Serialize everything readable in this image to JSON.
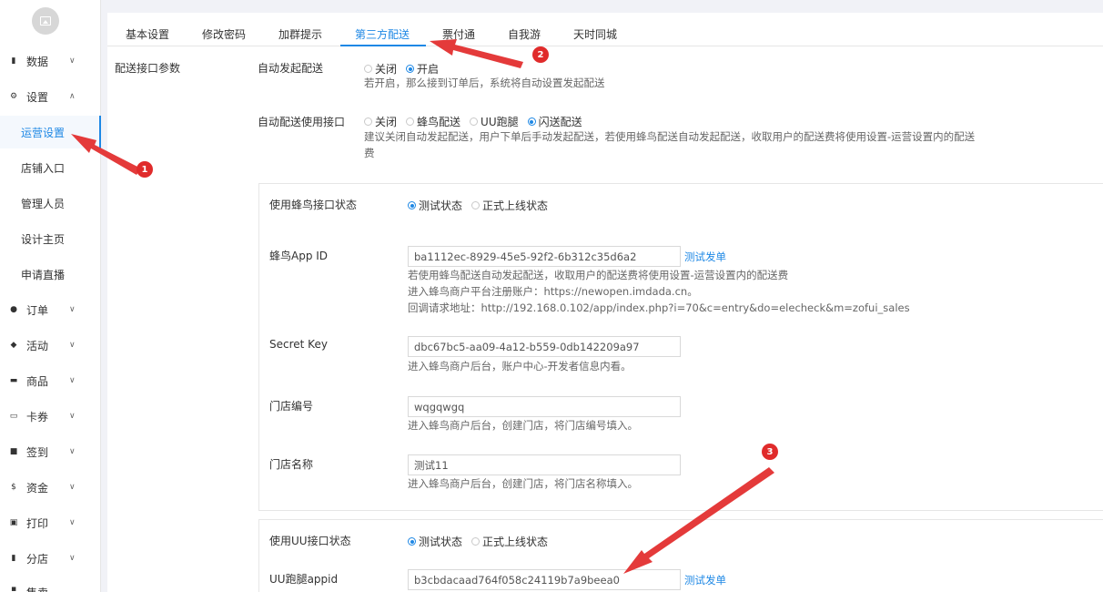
{
  "sidebar": {
    "items": [
      {
        "label": "数据",
        "icon": "bar-chart-icon"
      },
      {
        "label": "设置",
        "icon": "gear-icon"
      },
      {
        "label": "订单",
        "icon": "info-icon"
      },
      {
        "label": "活动",
        "icon": "tag-icon"
      },
      {
        "label": "商品",
        "icon": "basket-icon"
      },
      {
        "label": "卡券",
        "icon": "card-icon"
      },
      {
        "label": "签到",
        "icon": "cube-icon"
      },
      {
        "label": "资金",
        "icon": "dollar-icon"
      },
      {
        "label": "打印",
        "icon": "printer-icon"
      },
      {
        "label": "分店",
        "icon": "bar-chart-icon"
      },
      {
        "label": "售卖"
      }
    ],
    "sub_items": [
      "运营设置",
      "店铺入口",
      "管理人员",
      "设计主页",
      "申请直播"
    ]
  },
  "tabs": [
    "基本设置",
    "修改密码",
    "加群提示",
    "第三方配送",
    "票付通",
    "自我游",
    "天时同城"
  ],
  "section_label": "配送接口参数",
  "auto_dispatch": {
    "label": "自动发起配送",
    "options": [
      "关闭",
      "开启"
    ],
    "help": "若开启，那么接到订单后，系统将自动设置发起配送"
  },
  "auto_interface": {
    "label": "自动配送使用接口",
    "options": [
      "关闭",
      "蜂鸟配送",
      "UU跑腿",
      "闪送配送"
    ],
    "help_line1": "建议关闭自动发起配送，用户下单后手动发起配送，若使用蜂鸟配送自动发起配送，收取用户的配送费将使用设置-运营设置内的配送",
    "help_line2": "费"
  },
  "fengniao": {
    "status_label": "使用蜂鸟接口状态",
    "status_options": [
      "测试状态",
      "正式上线状态"
    ],
    "appid_label": "蜂鸟App ID",
    "appid_value": "ba1112ec-8929-45e5-92f2-6b312c35d6a2",
    "test_link": "测试发单",
    "appid_help1": "若使用蜂鸟配送自动发起配送，收取用户的配送费将使用设置-运营设置内的配送费",
    "appid_help2": "进入蜂鸟商户平台注册账户：https://newopen.imdada.cn。",
    "appid_help3": "回调请求地址：http://192.168.0.102/app/index.php?i=70&c=entry&do=elecheck&m=zofui_sales",
    "secret_label": "Secret Key",
    "secret_value": "dbc67bc5-aa09-4a12-b559-0db142209a97",
    "secret_help": "进入蜂鸟商户后台，账户中心-开发者信息内看。",
    "store_no_label": "门店编号",
    "store_no_value": "wqgqwgq",
    "store_no_help": "进入蜂鸟商户后台，创建门店，将门店编号填入。",
    "store_name_label": "门店名称",
    "store_name_value": "测试11",
    "store_name_help": "进入蜂鸟商户后台，创建门店，将门店名称填入。"
  },
  "uu": {
    "status_label": "使用UU接口状态",
    "status_options": [
      "测试状态",
      "正式上线状态"
    ],
    "appid_label": "UU跑腿appid",
    "appid_value": "b3cbdacaad764f058c24119b7a9beea0",
    "test_link": "测试发单"
  },
  "badges": [
    "1",
    "2",
    "3"
  ],
  "colors": {
    "accent": "#1e88e5",
    "annotation": "#e02b2b"
  }
}
